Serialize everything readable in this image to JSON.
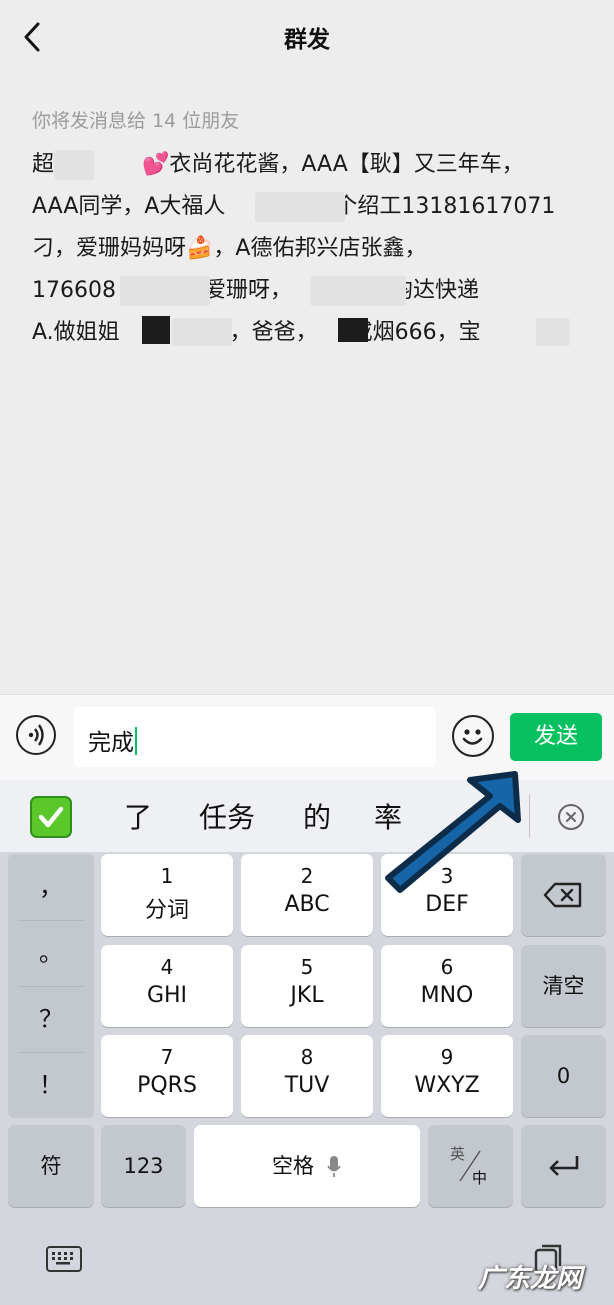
{
  "header": {
    "title": "群发"
  },
  "recipients": {
    "caption": "你将发消息给 14 位朋友",
    "lines": [
      "超　　　　💕衣尚花花酱，AAA【耿】又三年车，",
      "AAA同学，A大福人　　　　　个绍工13181617071",
      "刁，爱珊妈妈呀🍰，A德佑邦兴店张鑫，",
      "176608　　　　爱珊呀，　　　　　韵达快递",
      "A.做姐姐　　　　　，爸爸，　　戒烟666，宝"
    ]
  },
  "input": {
    "value": "完成",
    "send_label": "发送"
  },
  "keyboard": {
    "candidates": [
      "了",
      "任务",
      "的",
      "率"
    ],
    "punctuation": [
      "，",
      "。",
      "？",
      "！"
    ],
    "keys": [
      {
        "num": "1",
        "letters": "分词"
      },
      {
        "num": "2",
        "letters": "ABC"
      },
      {
        "num": "3",
        "letters": "DEF"
      },
      {
        "num": "4",
        "letters": "GHI"
      },
      {
        "num": "5",
        "letters": "JKL"
      },
      {
        "num": "6",
        "letters": "MNO"
      },
      {
        "num": "7",
        "letters": "PQRS"
      },
      {
        "num": "8",
        "letters": "TUV"
      },
      {
        "num": "9",
        "letters": "WXYZ"
      }
    ],
    "clear_label": "清空",
    "zero_label": "0",
    "symbol_label": "符",
    "num123_label": "123",
    "space_label": "空格",
    "lang_top": "英",
    "lang_bottom": "中"
  },
  "watermark": "广东龙网",
  "colors": {
    "accent": "#07c160",
    "arrow": "#1565a8"
  }
}
